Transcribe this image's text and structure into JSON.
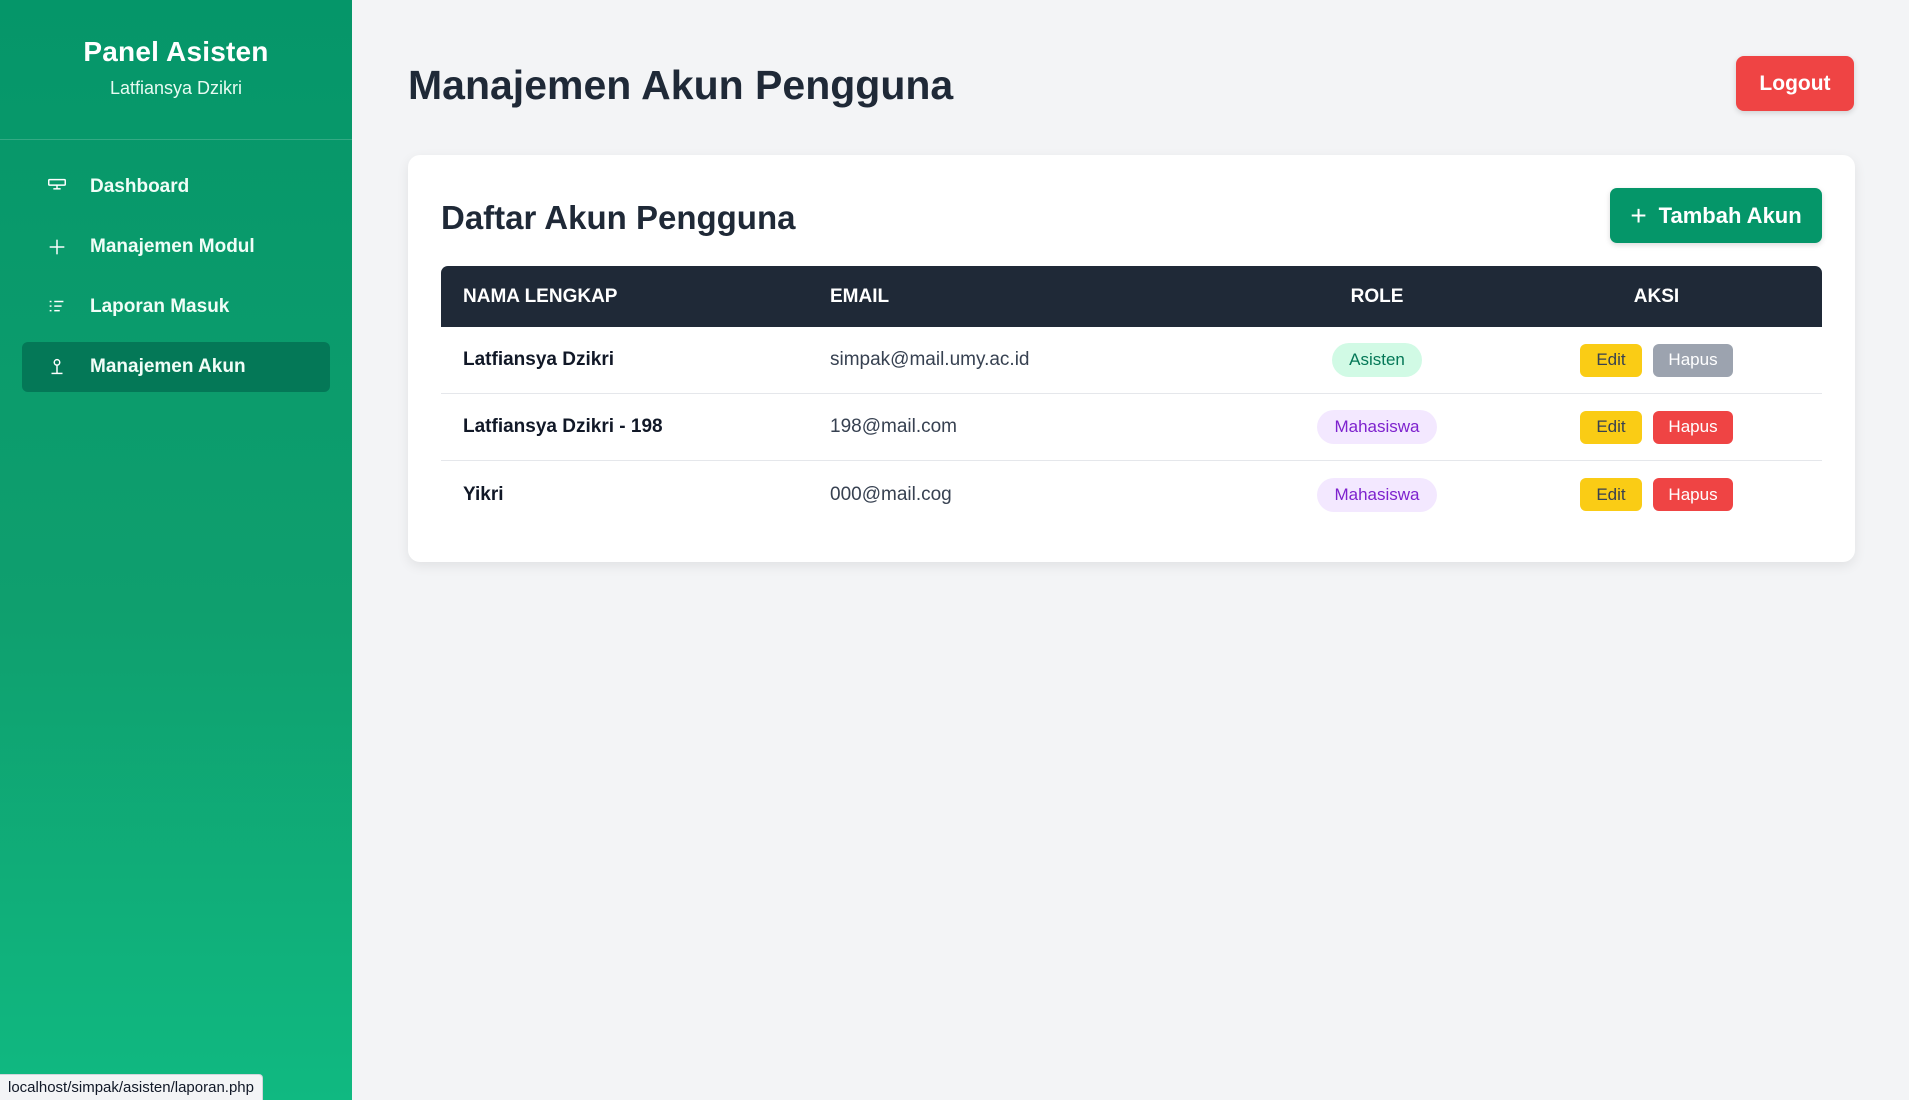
{
  "sidebar": {
    "title": "Panel Asisten",
    "user": "Latfiansya Dzikri",
    "items": [
      {
        "label": "Dashboard",
        "icon": "monitor-icon",
        "active": false
      },
      {
        "label": "Manajemen Modul",
        "icon": "plus-icon",
        "active": false
      },
      {
        "label": "Laporan Masuk",
        "icon": "list-icon",
        "active": false
      },
      {
        "label": "Manajemen Akun",
        "icon": "user-icon",
        "active": true
      }
    ]
  },
  "header": {
    "title": "Manajemen Akun Pengguna",
    "logout_label": "Logout"
  },
  "card": {
    "title": "Daftar Akun Pengguna",
    "add_label": "Tambah Akun"
  },
  "table": {
    "columns": [
      "NAMA LENGKAP",
      "EMAIL",
      "ROLE",
      "AKSI"
    ],
    "rows": [
      {
        "name": "Latfiansya Dzikri",
        "email": "simpak@mail.umy.ac.id",
        "role": "Asisten",
        "edit": "Edit",
        "delete": "Hapus",
        "delete_disabled": true
      },
      {
        "name": "Latfiansya Dzikri - 198",
        "email": "198@mail.com",
        "role": "Mahasiswa",
        "edit": "Edit",
        "delete": "Hapus",
        "delete_disabled": false
      },
      {
        "name": "Yikri",
        "email": "000@mail.cog",
        "role": "Mahasiswa",
        "edit": "Edit",
        "delete": "Hapus",
        "delete_disabled": false
      }
    ]
  },
  "statusbar": {
    "url": "localhost/simpak/asisten/laporan.php"
  },
  "colors": {
    "sidebar": "#059669",
    "active_item": "#047857",
    "logout": "#ef4444",
    "table_header": "#1f2937",
    "edit": "#facc15",
    "delete": "#ef4444",
    "delete_disabled": "#9ca3af"
  }
}
